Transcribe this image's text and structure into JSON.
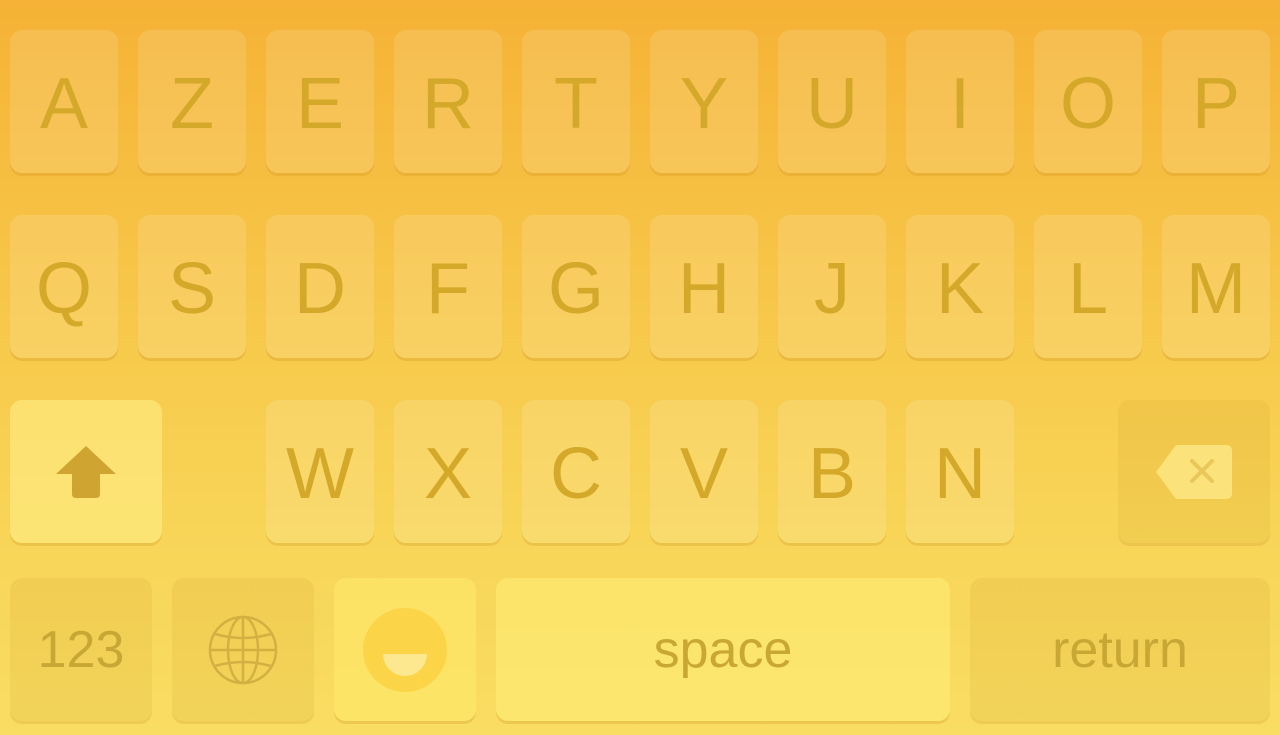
{
  "keyboard": {
    "row1": [
      "A",
      "Z",
      "E",
      "R",
      "T",
      "Y",
      "U",
      "I",
      "O",
      "P"
    ],
    "row2": [
      "Q",
      "S",
      "D",
      "F",
      "G",
      "H",
      "J",
      "K",
      "L",
      "M"
    ],
    "row3": [
      "W",
      "X",
      "C",
      "V",
      "B",
      "N"
    ],
    "bottom": {
      "numbers_label": "123",
      "space_label": "space",
      "return_label": "return"
    },
    "icons": {
      "shift": "shift-icon",
      "backspace": "backspace-icon",
      "globe": "globe-icon",
      "emoji": "emoji-icon"
    },
    "colors": {
      "background_top": "#f5b235",
      "background_bottom": "#f9dd62",
      "key_text": "#d4a828"
    }
  }
}
